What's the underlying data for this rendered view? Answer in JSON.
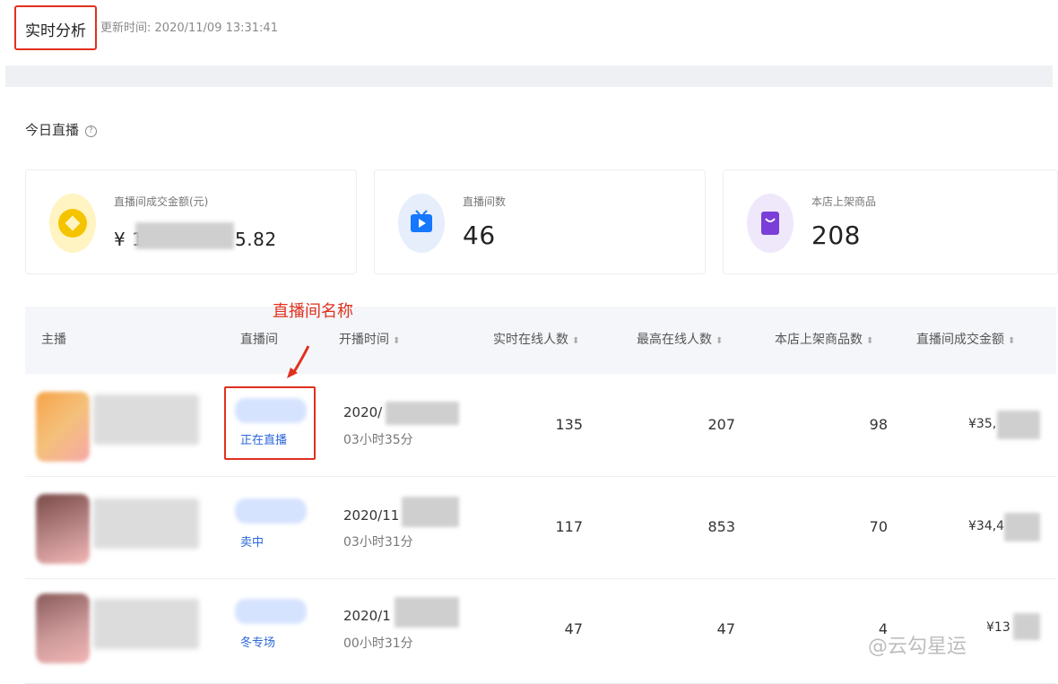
{
  "header": {
    "title": "实时分析",
    "update_label": "更新时间:",
    "update_time": "2020/11/09 13:31:41"
  },
  "today": {
    "section_title": "今日直播",
    "help_icon": "question-circle-icon"
  },
  "cards": [
    {
      "label": "直播间成交金额(元)",
      "value_prefix": "¥ 1",
      "value_suffix": "5.82",
      "icon": "coin-icon",
      "icon_bg": "#fff4c2",
      "icon_color": "#f5c400"
    },
    {
      "label": "直播间数",
      "value": "46",
      "icon": "tv-icon",
      "icon_bg": "#e6eefb",
      "icon_color": "#1677ff"
    },
    {
      "label": "本店上架商品",
      "value": "208",
      "icon": "bag-icon",
      "icon_bg": "#efe8fb",
      "icon_color": "#7a3fd8"
    }
  ],
  "table": {
    "columns": [
      "主播",
      "直播间",
      "开播时间",
      "实时在线人数",
      "最高在线人数",
      "本店上架商品数",
      "直播间成交金额"
    ],
    "rows": [
      {
        "room_label": "正在直播",
        "start": "2020/",
        "duration": "03小时35分",
        "online": "135",
        "peak": "207",
        "products": "98",
        "amount": "¥35,"
      },
      {
        "room_label": "卖中",
        "start": "2020/11",
        "duration": "03小时31分",
        "online": "117",
        "peak": "853",
        "products": "70",
        "amount": "¥34,4"
      },
      {
        "room_label": "冬专场",
        "start": "2020/1",
        "duration": "00小时31分",
        "online": "47",
        "peak": "47",
        "products": "4",
        "amount": "¥13"
      }
    ]
  },
  "annotation": {
    "text": "直播间名称",
    "color": "#e0301e"
  },
  "watermark": "@云勾星运"
}
